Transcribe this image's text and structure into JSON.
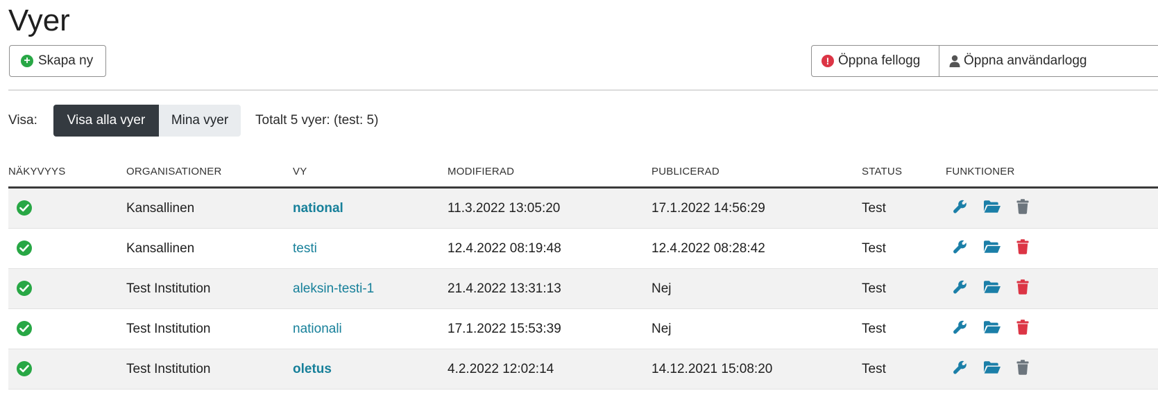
{
  "page": {
    "title": "Vyer"
  },
  "toolbar": {
    "create_label": "Skapa ny",
    "error_log_label": "Öppna fellogg",
    "user_log_label": "Öppna användarlogg"
  },
  "filter": {
    "label": "Visa:",
    "options": [
      {
        "label": "Visa alla vyer",
        "active": true
      },
      {
        "label": "Mina vyer",
        "active": false
      }
    ],
    "total_text": "Totalt 5 vyer: (test: 5)"
  },
  "table": {
    "headers": {
      "visibility": "NÄKYVYYS",
      "organisations": "ORGANISATIONER",
      "view": "VY",
      "modified": "MODIFIERAD",
      "published": "PUBLICERAD",
      "status": "STATUS",
      "functions": "FUNKTIONER"
    },
    "rows": [
      {
        "organisation": "Kansallinen",
        "view": "national",
        "view_bold": true,
        "modified": "11.3.2022 13:05:20",
        "published": "17.1.2022 14:56:29",
        "status": "Test",
        "delete_enabled": false
      },
      {
        "organisation": "Kansallinen",
        "view": "testi",
        "view_bold": false,
        "modified": "12.4.2022 08:19:48",
        "published": "12.4.2022 08:28:42",
        "status": "Test",
        "delete_enabled": true
      },
      {
        "organisation": "Test Institution",
        "view": "aleksin-testi-1",
        "view_bold": false,
        "modified": "21.4.2022 13:31:13",
        "published": "Nej",
        "status": "Test",
        "delete_enabled": true
      },
      {
        "organisation": "Test Institution",
        "view": "nationali",
        "view_bold": false,
        "modified": "17.1.2022 15:53:39",
        "published": "Nej",
        "status": "Test",
        "delete_enabled": true
      },
      {
        "organisation": "Test Institution",
        "view": "oletus",
        "view_bold": true,
        "modified": "4.2.2022 12:02:14",
        "published": "14.12.2021 15:08:20",
        "status": "Test",
        "delete_enabled": false
      }
    ]
  },
  "colors": {
    "accent_link": "#17809a",
    "success": "#28a745",
    "danger": "#dc3545",
    "disabled_icon": "#6c757d",
    "dark_button": "#343a40"
  },
  "icons": {
    "visibility": "check-circle-icon",
    "edit": "wrench-icon",
    "open": "folder-open-icon",
    "delete": "trash-icon"
  }
}
